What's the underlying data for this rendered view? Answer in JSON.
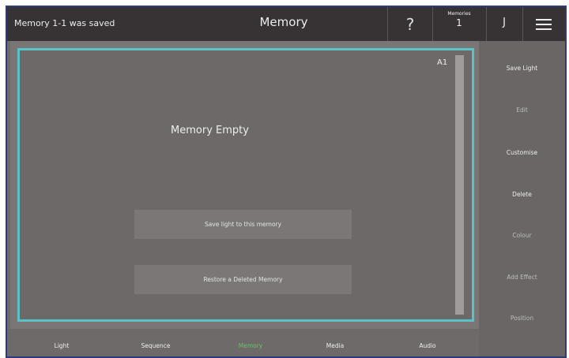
{
  "header": {
    "status_message": "Memory 1-1 was saved",
    "title": "Memory",
    "help_label": "?",
    "memories_label": "Memories",
    "memories_count": "1",
    "user_initial": "J",
    "menu_icon": "hamburger-menu-icon"
  },
  "memory_card": {
    "slot_id": "A1",
    "empty_label": "Memory Empty",
    "save_button_label": "Save light to this memory",
    "restore_button_label": "Restore a Deleted Memory"
  },
  "sidebar": {
    "items": [
      {
        "label": "Save Light",
        "enabled": true
      },
      {
        "label": "Edit",
        "enabled": false
      },
      {
        "label": "Customise",
        "enabled": true
      },
      {
        "label": "Delete",
        "enabled": true
      },
      {
        "label": "Colour",
        "enabled": false
      },
      {
        "label": "Add Effect",
        "enabled": false
      },
      {
        "label": "Position",
        "enabled": false
      }
    ]
  },
  "bottom_nav": {
    "items": [
      {
        "label": "Light"
      },
      {
        "label": "Sequence"
      },
      {
        "label": "Memory",
        "active": true
      },
      {
        "label": "Media"
      },
      {
        "label": "Audio"
      }
    ]
  },
  "colors": {
    "accent_border": "#58c2c4",
    "active_tab": "#5fc85f",
    "header_bg": "#373334"
  }
}
